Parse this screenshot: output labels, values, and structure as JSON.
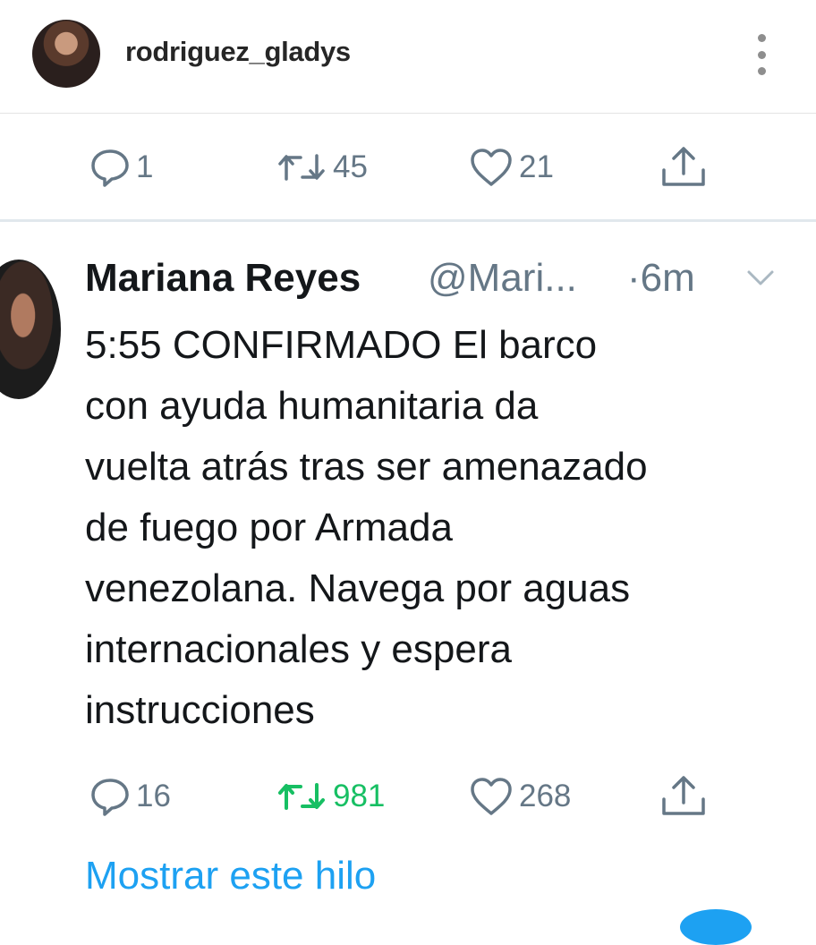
{
  "instagram": {
    "username": "rodriguez_gladys"
  },
  "top_actions": {
    "replies": "1",
    "retweets": "45",
    "likes": "21"
  },
  "tweet": {
    "name": "Mariana Reyes",
    "handle": "@Mari...",
    "time": "·6m",
    "text": "5:55 CONFIRMADO El barco\ncon ayuda humanitaria da\nvuelta atrás tras ser amenazado\nde fuego por Armada\nvenezolana. Navega por aguas\ninternacionales y espera\ninstrucciones",
    "replies": "16",
    "retweets": "981",
    "likes": "268",
    "show_thread": "Mostrar este hilo"
  },
  "colors": {
    "action_gray": "#657786",
    "retweeted_green": "#17bf63",
    "link_blue": "#1da1f2"
  }
}
